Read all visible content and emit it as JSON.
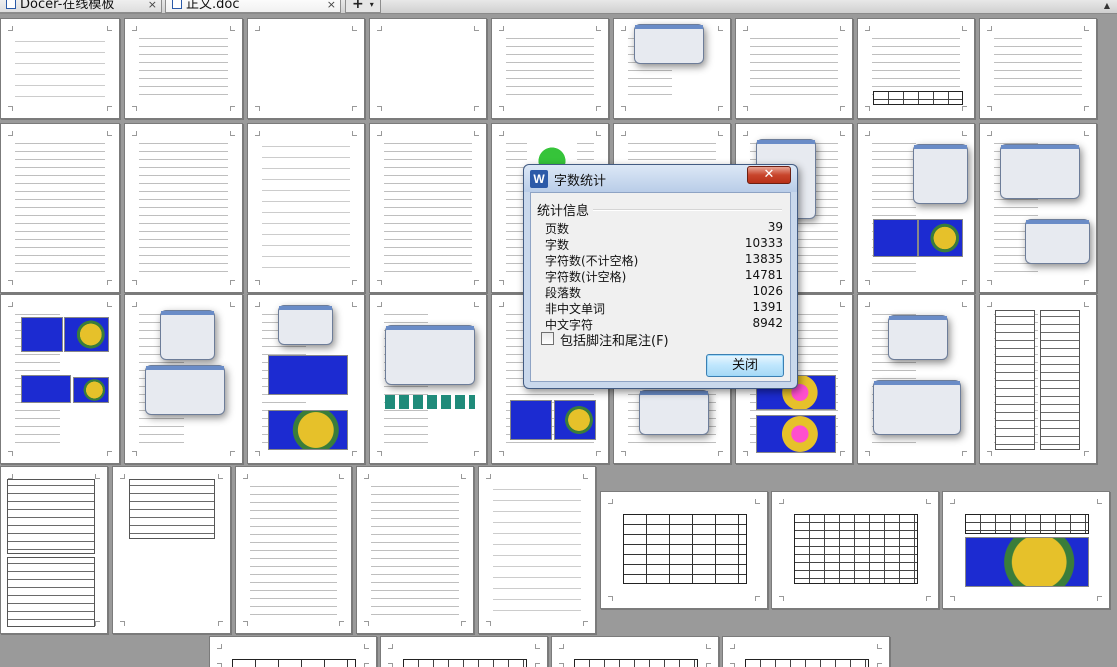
{
  "tabs": [
    {
      "label": "Docer-在线模板",
      "close": "×",
      "active": false
    },
    {
      "label": "正文.doc",
      "close": "×",
      "active": true
    }
  ],
  "new_tab": {
    "plus": "+",
    "dropdown": "▾"
  },
  "dialog": {
    "title": "字数统计",
    "icon_letter": "W",
    "close_symbol": "✕",
    "group_label": "统计信息",
    "stats": [
      {
        "label": "页数",
        "value": "39"
      },
      {
        "label": "字数",
        "value": "10333"
      },
      {
        "label": "字符数(不计空格)",
        "value": "13835"
      },
      {
        "label": "字符数(计空格)",
        "value": "14781"
      },
      {
        "label": "段落数",
        "value": "1026"
      },
      {
        "label": "非中文单词",
        "value": "1391"
      },
      {
        "label": "中文字符",
        "value": "8942"
      }
    ],
    "include_footnotes_label": "包括脚注和尾注(F)",
    "include_footnotes_checked": false,
    "close_button_label": "关闭"
  }
}
